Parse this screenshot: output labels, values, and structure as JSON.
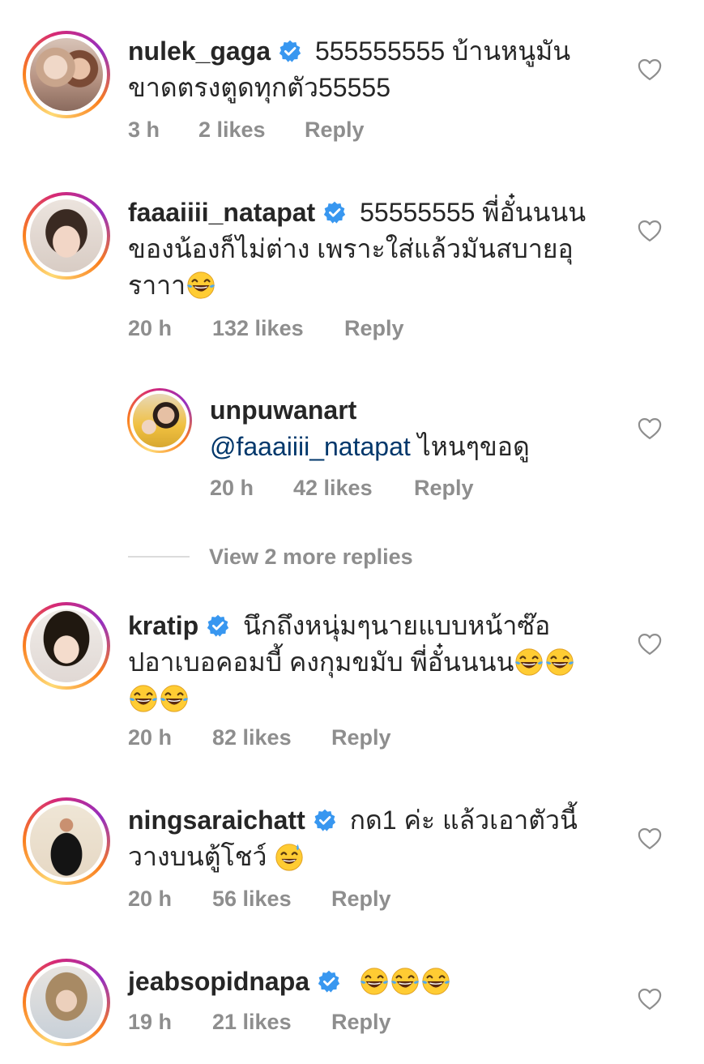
{
  "comments": [
    {
      "username": "nulek_gaga",
      "verified": true,
      "text_line1": "555555555 บ้านหนูมัน",
      "text_line2": "ขาดตรงตูดทุกตัว55555",
      "time": "3 h",
      "likes": "2 likes",
      "reply": "Reply"
    },
    {
      "username": "faaaiiii_natapat",
      "verified": true,
      "text_line1": "55555555 พี่อั๋นนนน",
      "text_line2": "ของน้องก็ไม่ต่าง เพราะใส่แล้วมันสบายอุ",
      "text_line3": "ราาา",
      "time": "20 h",
      "likes": "132 likes",
      "reply": "Reply"
    },
    {
      "username": "unpuwanart",
      "verified": false,
      "mention": "@faaaiiii_natapat",
      "text": " ไหนๆขอดู",
      "time": "20 h",
      "likes": "42 likes",
      "reply": "Reply"
    },
    {
      "username": "kratip",
      "verified": true,
      "text_line1": "นึกถึงหนุ่มๆนายแบบหน้าซ๊อ",
      "text_line2": "ปอาเบอคอมบี้ คงกุมขมับ พี่อั๋นนนน",
      "time": "20 h",
      "likes": "82 likes",
      "reply": "Reply"
    },
    {
      "username": "ningsaraichatt",
      "verified": true,
      "text_line1": "กด1 ค่ะ แล้วเอาตัวนี้",
      "text_line2": "วางบนตู้โชว์",
      "time": "20 h",
      "likes": "56 likes",
      "reply": "Reply"
    },
    {
      "username": "jeabsopidnapa",
      "verified": true,
      "time": "19 h",
      "likes": "21 likes",
      "reply": "Reply"
    }
  ],
  "view_more_replies": "View 2 more replies",
  "icons": {
    "verified": "verified-badge-icon",
    "like": "heart-icon",
    "emoji_laugh": "tears-of-joy-emoji",
    "emoji_sweat": "grinning-sweat-emoji"
  },
  "colors": {
    "verified_blue": "#3897f0",
    "meta_gray": "#8e8e8e",
    "mention_blue": "#00376b"
  }
}
